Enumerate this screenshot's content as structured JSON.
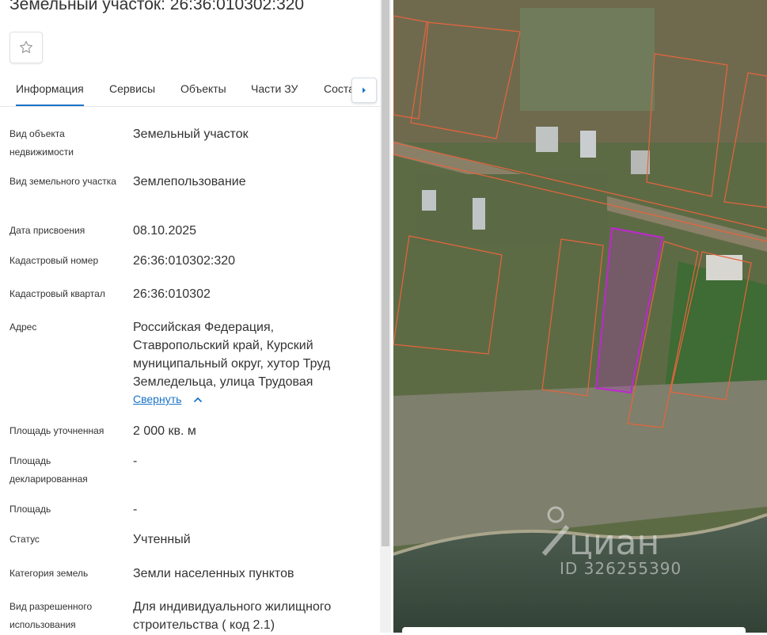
{
  "header": {
    "title": "Земельный участок: 26:36:010302:320"
  },
  "favorite": {
    "icon": "star-icon"
  },
  "tabs": [
    {
      "label": "Информация",
      "active": true
    },
    {
      "label": "Сервисы"
    },
    {
      "label": "Объекты"
    },
    {
      "label": "Части ЗУ"
    },
    {
      "label": "Соста"
    }
  ],
  "tab_scroll_icon": "caret-right-icon",
  "fields": {
    "object_type": {
      "label": "Вид объекта недвижимости",
      "value": "Земельный участок"
    },
    "land_type": {
      "label": "Вид земельного участка",
      "value": "Землепользование"
    },
    "assign_date": {
      "label": "Дата присвоения",
      "value": "08.10.2025"
    },
    "cadastral_number": {
      "label": "Кадастровый номер",
      "value": "26:36:010302:320"
    },
    "cadastral_quarter": {
      "label": "Кадастровый квартал",
      "value": "26:36:010302"
    },
    "address": {
      "label": "Адрес",
      "value": "Российская Федерация, Ставропольский край, Курский муниципальный округ, хутор Труд Земледельца, улица Трудовая",
      "collapse_label": "Свернуть"
    },
    "area_specified": {
      "label": "Площадь уточненная",
      "value": "2 000 кв. м"
    },
    "area_declared": {
      "label": "Площадь декларированная",
      "value": "-"
    },
    "area": {
      "label": "Площадь",
      "value": "-"
    },
    "status": {
      "label": "Статус",
      "value": "Учтенный"
    },
    "land_category": {
      "label": "Категория земель",
      "value": "Земли населенных пунктов"
    },
    "permitted_use": {
      "label": "Вид разрешенного использования",
      "value": "Для индивидуального жилищного строительства ( код 2.1)"
    }
  },
  "map": {
    "watermark_brand": "циан",
    "watermark_id": "ID 326255390",
    "selected_color": "#c026d3",
    "parcel_color": "#e8643c"
  }
}
